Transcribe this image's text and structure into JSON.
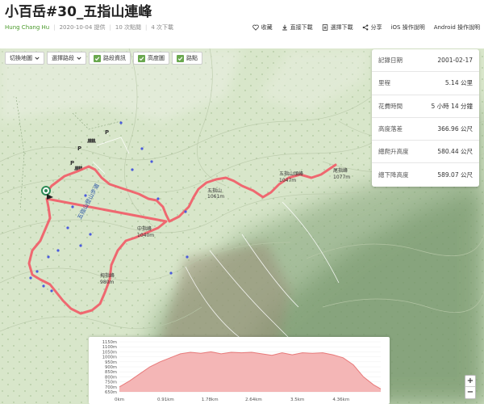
{
  "header": {
    "title": "小百岳#30_五指山連峰",
    "author": "Hung Chang Hu",
    "date": "2020-10-04 提供",
    "clicks": "10 次點閱",
    "downloads": "4 次下載"
  },
  "actions": [
    {
      "label": "收藏",
      "icon": "heart-icon"
    },
    {
      "label": "直接下載",
      "icon": "download-icon"
    },
    {
      "label": "選擇下載",
      "icon": "file-download-icon"
    },
    {
      "label": "分享",
      "icon": "share-icon"
    },
    {
      "label": "iOS 操作說明",
      "icon": ""
    },
    {
      "label": "Android 操作說明",
      "icon": ""
    }
  ],
  "toolbar": {
    "switch_map": "切換地圖",
    "select_route": "選擇路段",
    "route_info": "路段資訊",
    "elevation": "高度圖",
    "waypoints": "路點"
  },
  "info": [
    {
      "label": "記錄日期",
      "value": "2001-02-17"
    },
    {
      "label": "里程",
      "value": "5.14 公里"
    },
    {
      "label": "花費時間",
      "value": "5 小時 14 分鐘"
    },
    {
      "label": "高度落差",
      "value": "366.96 公尺"
    },
    {
      "label": "總爬升高度",
      "value": "580.44 公尺"
    },
    {
      "label": "總下降高度",
      "value": "589.07 公尺"
    }
  ],
  "map_labels": {
    "trail": "五指山登山步道",
    "peak1_name": "五指山",
    "peak1_elev": "1061m",
    "peak2_name": "五指山頭峰",
    "peak2_elev": "1047m",
    "peak3_name": "中指峰",
    "peak3_elev": "1040m",
    "peak4_name": "拇指峰",
    "peak4_elev": "980m",
    "peak5_name": "尾指峰",
    "peak5_elev": "1077m"
  },
  "elevation_chart": {
    "y_ticks": [
      "1150m",
      "1100m",
      "1050m",
      "1000m",
      "950m",
      "900m",
      "850m",
      "800m",
      "750m",
      "700m",
      "650m"
    ],
    "x_ticks": [
      "0km",
      "0.91km",
      "1.78km",
      "2.64km",
      "3.5km",
      "4.36km"
    ],
    "profile_km": [
      0,
      0.2,
      0.4,
      0.6,
      0.8,
      1.0,
      1.2,
      1.4,
      1.6,
      1.8,
      2.0,
      2.2,
      2.4,
      2.6,
      2.8,
      3.0,
      3.2,
      3.4,
      3.6,
      3.8,
      4.0,
      4.2,
      4.4,
      4.6,
      4.8,
      5.0,
      5.14
    ],
    "profile_m": [
      700,
      760,
      830,
      900,
      950,
      990,
      1030,
      1045,
      1035,
      1050,
      1030,
      1045,
      1040,
      1045,
      1030,
      1015,
      1040,
      1020,
      1040,
      1035,
      1040,
      1020,
      990,
      920,
      800,
      720,
      680
    ],
    "colors": {
      "fill": "#f4b6b6",
      "line": "#e87a7a"
    }
  },
  "zoom": {
    "in": "+",
    "out": "−"
  },
  "colors": {
    "track": "#f25a66",
    "accent": "#6aa84f",
    "author": "#4a9a2a"
  }
}
